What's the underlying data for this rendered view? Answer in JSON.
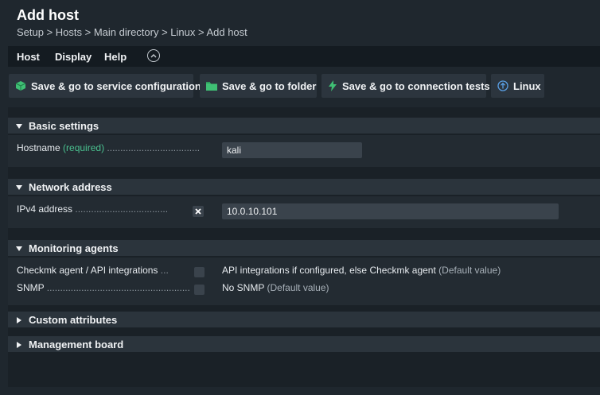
{
  "header": {
    "title": "Add host",
    "breadcrumb": "Setup > Hosts > Main directory > Linux > Add host"
  },
  "menu": {
    "host": "Host",
    "display": "Display",
    "help": "Help"
  },
  "toolbar": {
    "service_config": "Save & go to service configuration",
    "folder": "Save & go to folder",
    "connection_tests": "Save & go to connection tests",
    "linux": "Linux"
  },
  "sections": {
    "basic": {
      "title": "Basic settings",
      "hostname_label": "Hostname",
      "hostname_required": "(required)",
      "hostname_dots": "...................................",
      "hostname_value": "kali"
    },
    "network": {
      "title": "Network address",
      "ipv4_label": "IPv4 address",
      "ipv4_dots": "...................................",
      "ipv4_value": "10.0.10.101"
    },
    "monitoring": {
      "title": "Monitoring agents",
      "agent_label": "Checkmk agent / API integrations",
      "agent_dots": "...",
      "agent_value": "API integrations if configured, else Checkmk agent",
      "agent_default": "(Default value)",
      "snmp_label": "SNMP",
      "snmp_dots": "......................................................",
      "snmp_value": "No SNMP",
      "snmp_default": "(Default value)"
    },
    "custom": {
      "title": "Custom attributes"
    },
    "management": {
      "title": "Management board"
    }
  },
  "colors": {
    "accent_green": "#4ac08f",
    "info_blue": "#5aa0e6"
  }
}
